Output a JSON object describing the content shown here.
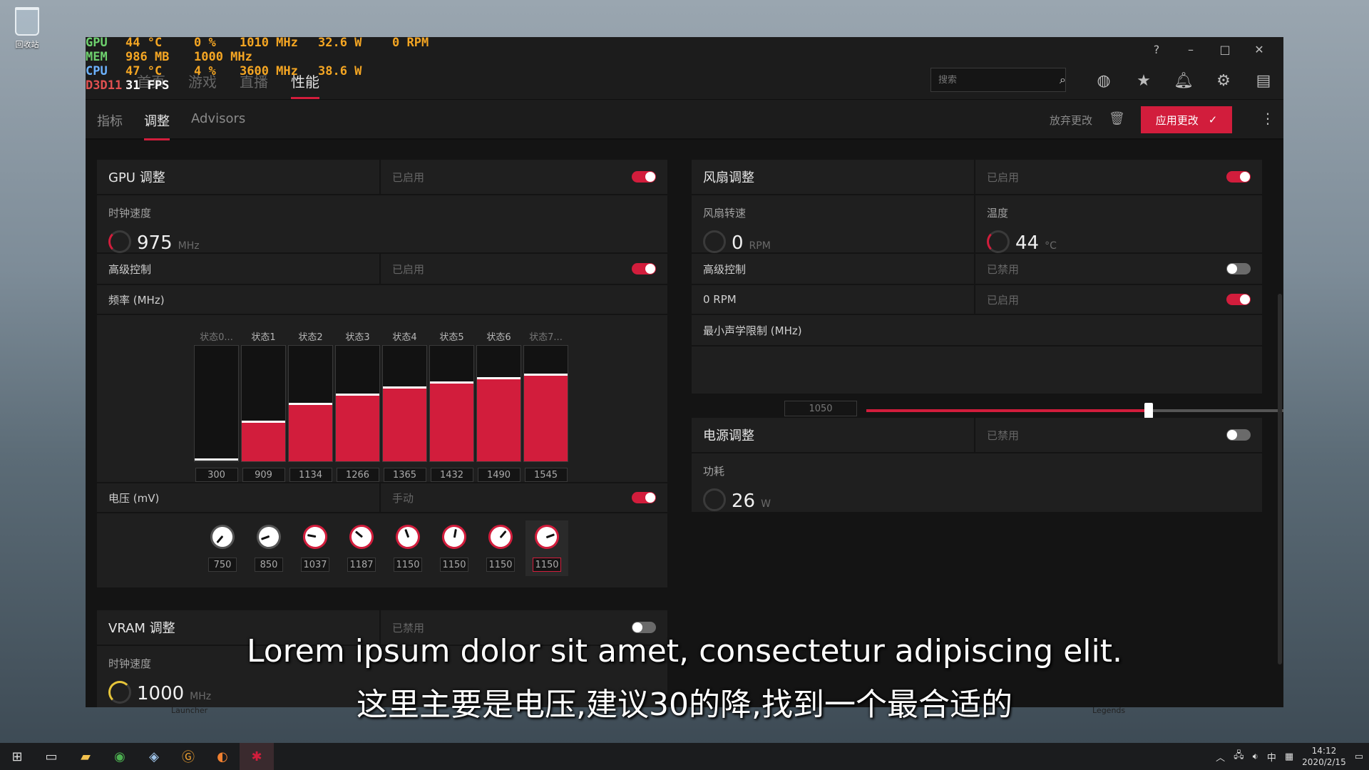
{
  "desktop": {
    "recycle_label": "回收站",
    "launcher_label": "Launcher",
    "legends_label": "Legends"
  },
  "osd": {
    "rows": [
      {
        "tag": "GPU",
        "vals": [
          "44 °C",
          "0 %",
          "1010 MHz",
          "32.6 W",
          "0 RPM"
        ]
      },
      {
        "tag": "MEM",
        "vals": [
          "986 MB",
          "1000 MHz"
        ]
      },
      {
        "tag": "CPU",
        "vals": [
          "47 °C",
          "4 %",
          "3600 MHz",
          "38.6 W"
        ]
      },
      {
        "tag": "D3D11",
        "vals": [
          "31 FPS"
        ]
      }
    ],
    "colors": {
      "gpu": "#6ed16e",
      "mem": "#6ed16e",
      "cpu": "#6db3ff",
      "d3d": "#e05050"
    }
  },
  "titlebar": {
    "help": "?",
    "minimize": "–",
    "maximize": "□",
    "close": "✕"
  },
  "topnav": {
    "tabs": [
      {
        "label": "首页",
        "active": false
      },
      {
        "label": "游戏",
        "active": false
      },
      {
        "label": "直播",
        "active": false
      },
      {
        "label": "性能",
        "active": true
      }
    ],
    "search_placeholder": "搜索"
  },
  "subnav": {
    "tabs": [
      {
        "label": "指标",
        "active": false
      },
      {
        "label": "调整",
        "active": true
      },
      {
        "label": "Advisors",
        "active": false
      }
    ],
    "discard_label": "放弃更改",
    "apply_label": "应用更改"
  },
  "gpu_tuning": {
    "title": "GPU 调整",
    "state": "已启用",
    "clock_label": "时钟速度",
    "clock_value": "975",
    "clock_unit": "MHz",
    "advanced_label": "高级控制",
    "advanced_state": "已启用",
    "freq_label": "频率 (MHz)",
    "states": [
      "状态0...",
      "状态1",
      "状态2",
      "状态3",
      "状态4",
      "状态5",
      "状态6",
      "状态7..."
    ],
    "freq_values": [
      "300",
      "909",
      "1134",
      "1266",
      "1365",
      "1432",
      "1490",
      "1545"
    ],
    "freq_fill": [
      0.0,
      0.35,
      0.5,
      0.58,
      0.64,
      0.68,
      0.72,
      0.75
    ],
    "voltage_label": "电压 (mV)",
    "voltage_mode": "手动",
    "voltage_values": [
      "750",
      "850",
      "1037",
      "1187",
      "1150",
      "1150",
      "1150",
      "1150"
    ]
  },
  "vram_tuning": {
    "title": "VRAM 调整",
    "state": "已禁用",
    "clock_label": "时钟速度",
    "clock_value": "1000",
    "clock_unit": "MHz"
  },
  "fan_tuning": {
    "title": "风扇调整",
    "state": "已启用",
    "speed_label": "风扇转速",
    "speed_value": "0",
    "speed_unit": "RPM",
    "temp_label": "温度",
    "temp_value": "44",
    "temp_unit": "°C",
    "advanced_label": "高级控制",
    "advanced_state": "已禁用",
    "zero_rpm_label": "0 RPM",
    "zero_rpm_state": "已启用",
    "acoustic_label": "最小声学限制 (MHz)",
    "acoustic_value": "1050",
    "acoustic_fraction": 0.6
  },
  "power_tuning": {
    "title": "电源调整",
    "state": "已禁用",
    "power_label": "功耗",
    "power_value": "26",
    "power_unit": "W"
  },
  "subtitles": {
    "line1": "Lorem ipsum dolor sit amet, consectetur adipiscing elit.",
    "line2": "这里主要是电压,建议30的降,找到一个最合适的"
  },
  "taskbar": {
    "time": "14:12",
    "date": "2020/2/15",
    "ime": "中"
  },
  "accent": "#d21d3c"
}
